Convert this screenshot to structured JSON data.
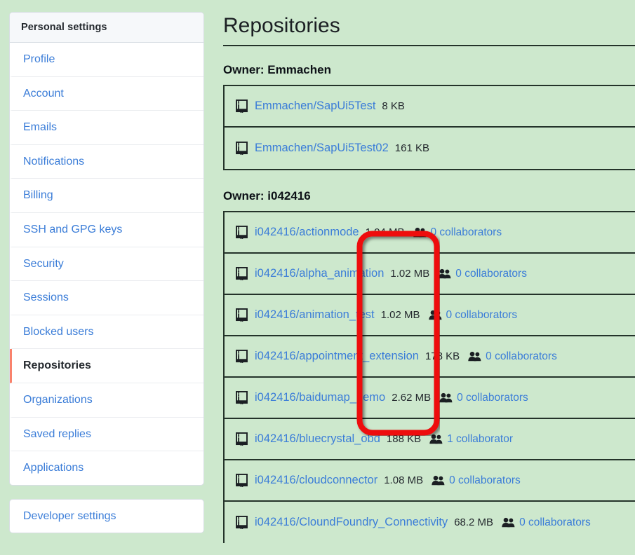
{
  "sidebar": {
    "header": "Personal settings",
    "items": [
      {
        "label": "Profile",
        "active": false
      },
      {
        "label": "Account",
        "active": false
      },
      {
        "label": "Emails",
        "active": false
      },
      {
        "label": "Notifications",
        "active": false
      },
      {
        "label": "Billing",
        "active": false
      },
      {
        "label": "SSH and GPG keys",
        "active": false
      },
      {
        "label": "Security",
        "active": false
      },
      {
        "label": "Sessions",
        "active": false
      },
      {
        "label": "Blocked users",
        "active": false
      },
      {
        "label": "Repositories",
        "active": true
      },
      {
        "label": "Organizations",
        "active": false
      },
      {
        "label": "Saved replies",
        "active": false
      },
      {
        "label": "Applications",
        "active": false
      }
    ],
    "developer_settings": "Developer settings"
  },
  "main": {
    "page_title": "Repositories",
    "sections": [
      {
        "owner_heading": "Owner: Emmachen",
        "repos": [
          {
            "name": "Emmachen/SapUi5Test",
            "size": "8 KB",
            "collaborators": ""
          },
          {
            "name": "Emmachen/SapUi5Test02",
            "size": "161 KB",
            "collaborators": ""
          }
        ]
      },
      {
        "owner_heading": "Owner: i042416",
        "repos": [
          {
            "name": "i042416/actionmode",
            "size": "1.04 MB",
            "collaborators": "0 collaborators"
          },
          {
            "name": "i042416/alpha_animation",
            "size": "1.02 MB",
            "collaborators": "0 collaborators"
          },
          {
            "name": "i042416/animation_test",
            "size": "1.02 MB",
            "collaborators": "0 collaborators"
          },
          {
            "name": "i042416/appointment_extension",
            "size": "178 KB",
            "collaborators": "0 collaborators"
          },
          {
            "name": "i042416/baidumap_demo",
            "size": "2.62 MB",
            "collaborators": "0 collaborators"
          },
          {
            "name": "i042416/bluecrystal_obd",
            "size": "188 KB",
            "collaborators": "1 collaborator"
          },
          {
            "name": "i042416/cloudconnector",
            "size": "1.08 MB",
            "collaborators": "0 collaborators"
          },
          {
            "name": "i042416/CloundFoundry_Connectivity",
            "size": "68.2 MB",
            "collaborators": "0 collaborators"
          }
        ]
      }
    ]
  },
  "annotation": {
    "shape": "rounded-rectangle-highlight",
    "color": "#ee1111"
  },
  "icons": {
    "repo": "repo-book-icon",
    "collaborators": "people-icon"
  },
  "colors": {
    "page_background": "#cde8cd",
    "link": "#3b7dd8",
    "active_marker": "#f9826c",
    "border": "#24332a",
    "annotation": "#ee1111"
  }
}
